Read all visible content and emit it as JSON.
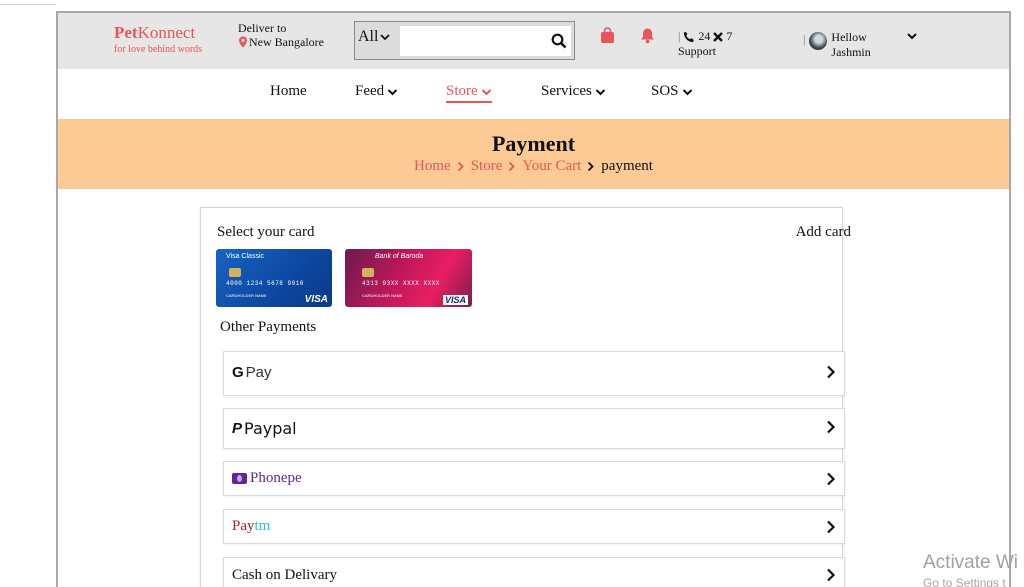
{
  "header": {
    "brand_pet": "Pet",
    "brand_konnect": "Konnect",
    "brand_tagline": "for love behind words",
    "deliver_label": "Deliver to",
    "deliver_location": "New Bangalore",
    "search_category": "All",
    "search_placeholder": "",
    "support_line1": "24",
    "support_x": "7",
    "support_line2": "Support",
    "user_greeting": "Hellow",
    "user_name": "Jashmin"
  },
  "nav": {
    "items": [
      {
        "label": "Home"
      },
      {
        "label": "Feed"
      },
      {
        "label": "Store"
      },
      {
        "label": "Services"
      },
      {
        "label": "SOS"
      }
    ]
  },
  "banner": {
    "title": "Payment",
    "breadcrumbs": [
      "Home",
      "Store",
      "Your Cart",
      "payment"
    ]
  },
  "payment": {
    "select_card_label": "Select your card",
    "add_card_label": "Add card",
    "cards": [
      {
        "title": "Visa Classic",
        "number": "4000 1234 5678 9010",
        "holder": "CARDHOLDER NAME",
        "network": "VISA"
      },
      {
        "title": "Bank of Baroda",
        "number": "4313 93XX XXXX XXXX",
        "holder": "CARDHOLDER NAME",
        "network": "VISA"
      }
    ],
    "other_payments_label": "Other Payments",
    "methods": [
      {
        "g": "G",
        "label": "Pay"
      },
      {
        "mark": "P",
        "label": "Paypal"
      },
      {
        "label": "Phonepe"
      },
      {
        "a": "Pay",
        "b": "tm"
      },
      {
        "label": "Cash on Delivary"
      }
    ]
  },
  "watermark": {
    "line1": "Activate Wi",
    "line2": "Go to Settings t"
  },
  "colors": {
    "accent": "#e8545a",
    "header_bg": "#e6e6e6",
    "banner_bg": "#fdc994",
    "phonepe": "#5f259f",
    "paytm_red": "#b22222",
    "paytm_cyan": "#22c4e0"
  },
  "icons": {
    "search": "search-icon",
    "bag": "shopping-bag-icon",
    "bell": "bell-icon",
    "phone": "phone-icon",
    "pin": "map-pin-icon",
    "chevron": "chevron-right-icon"
  }
}
